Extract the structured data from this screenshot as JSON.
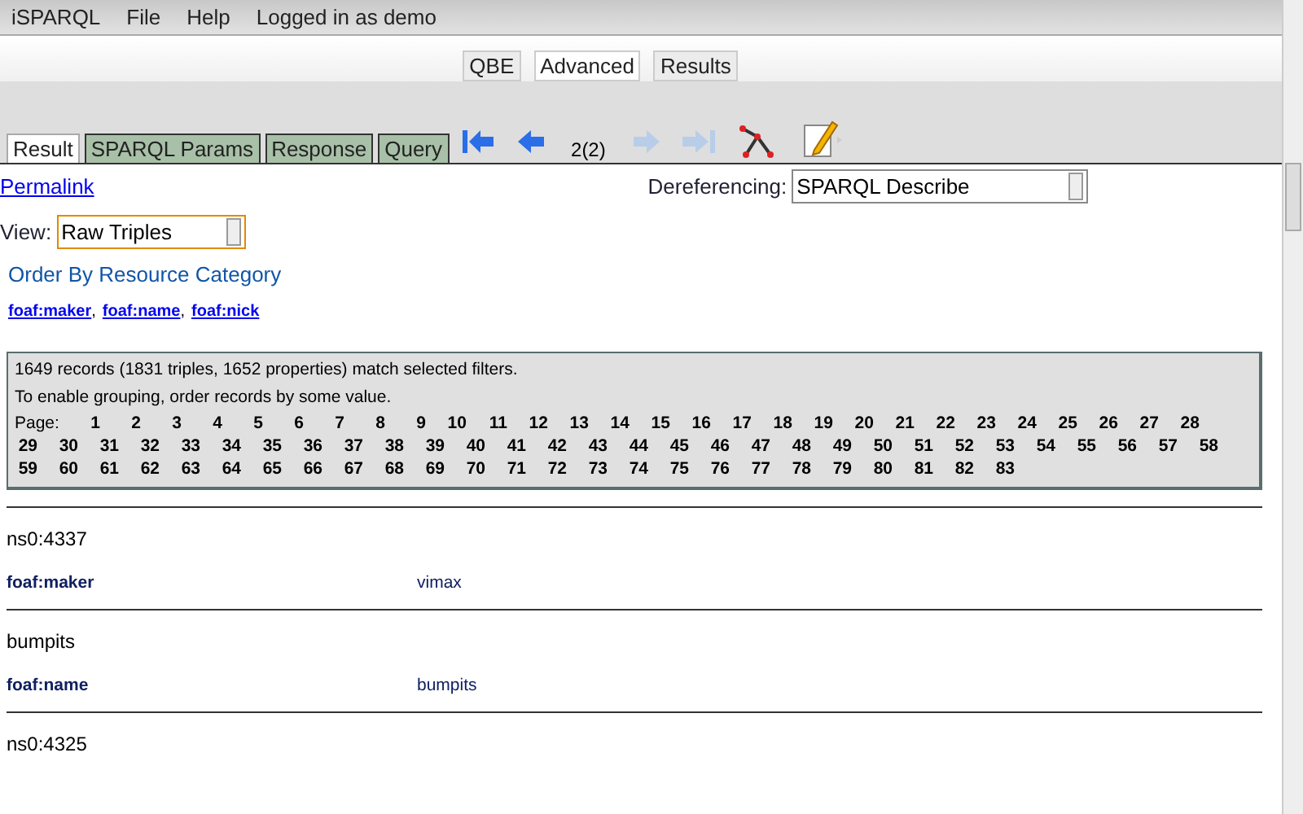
{
  "menu": [
    "iSPARQL",
    "File",
    "Help",
    "Logged in as demo"
  ],
  "mode_tabs": [
    {
      "label": "QBE",
      "selected": false
    },
    {
      "label": "Advanced",
      "selected": true
    },
    {
      "label": "Results",
      "selected": false
    }
  ],
  "result_tabs": [
    {
      "label": "Result",
      "selected": true
    },
    {
      "label": "SPARQL Params",
      "selected": false
    },
    {
      "label": "Response",
      "selected": false
    },
    {
      "label": "Query",
      "selected": false
    }
  ],
  "nav": {
    "first_disabled": false,
    "prev_disabled": false,
    "position": "2(2)",
    "next_disabled": true,
    "last_disabled": true
  },
  "permalink": "Permalink",
  "dereferencing": {
    "label": "Dereferencing:",
    "value": "SPARQL Describe"
  },
  "view": {
    "label": "View:",
    "value": "Raw Triples"
  },
  "order_link": "Order By Resource Category",
  "properties": {
    "separator": ",",
    "items": [
      "foaf:maker",
      "foaf:name",
      "foaf:nick"
    ]
  },
  "summary": {
    "records": "1649 records (1831 triples, 1652 properties) match selected filters.",
    "hint": "To enable grouping, order records by some value.",
    "page_label": "Page:",
    "pages": [
      "1",
      "2",
      "3",
      "4",
      "5",
      "6",
      "7",
      "8",
      "9",
      "10",
      "11",
      "12",
      "13",
      "14",
      "15",
      "16",
      "17",
      "18",
      "19",
      "20",
      "21",
      "22",
      "23",
      "24",
      "25",
      "26",
      "27",
      "28",
      "29",
      "30",
      "31",
      "32",
      "33",
      "34",
      "35",
      "36",
      "37",
      "38",
      "39",
      "40",
      "41",
      "42",
      "43",
      "44",
      "45",
      "46",
      "47",
      "48",
      "49",
      "50",
      "51",
      "52",
      "53",
      "54",
      "55",
      "56",
      "57",
      "58",
      "59",
      "60",
      "61",
      "62",
      "63",
      "64",
      "65",
      "66",
      "67",
      "68",
      "69",
      "70",
      "71",
      "72",
      "73",
      "74",
      "75",
      "76",
      "77",
      "78",
      "79",
      "80",
      "81",
      "82",
      "83"
    ]
  },
  "records": [
    {
      "subject": "ns0:4337",
      "triples": [
        {
          "predicate": "foaf:maker",
          "object": "vimax"
        }
      ]
    },
    {
      "subject": "bumpits",
      "triples": [
        {
          "predicate": "foaf:name",
          "object": "bumpits"
        }
      ]
    },
    {
      "subject": "ns0:4325"
    }
  ]
}
